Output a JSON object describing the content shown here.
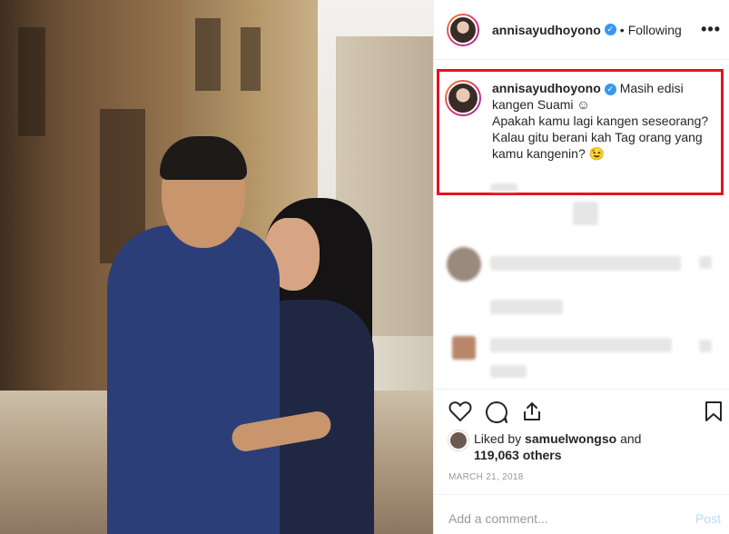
{
  "post": {
    "header": {
      "username": "annisayudhoyono",
      "separator": "•",
      "follow_status": "Following",
      "more": "•••"
    },
    "caption": {
      "username": "annisayudhoyono",
      "line1": "Masih edisi kangen Suami ☺",
      "line2": "Apakah kamu lagi kangen seseorang? Kalau gitu berani kah Tag orang yang kamu kangenin? 😉"
    },
    "likes": {
      "prefix": "Liked by",
      "user": "samuelwongso",
      "conjunction": "and",
      "count": "119,063 others"
    },
    "date": "MARCH 21, 2018",
    "comment": {
      "placeholder": "Add a comment...",
      "post_label": "Post"
    }
  },
  "colors": {
    "accent": "#3897f0",
    "highlight_box": "#e3141f",
    "post_disabled": "#b2dffc"
  },
  "icons": [
    "heart-icon",
    "comment-icon",
    "share-icon",
    "bookmark-icon",
    "more-icon",
    "verified-icon"
  ]
}
